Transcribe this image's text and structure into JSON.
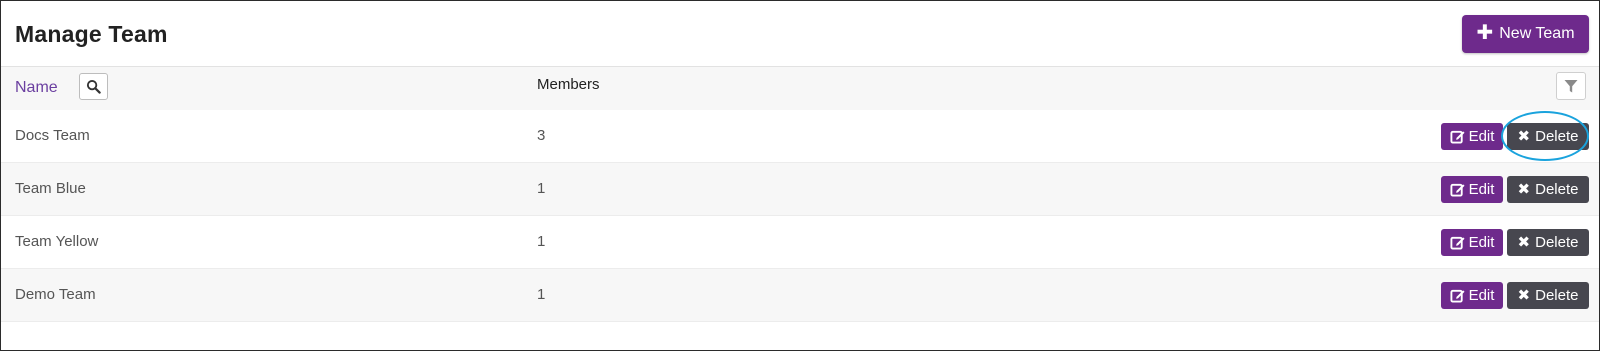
{
  "header": {
    "title": "Manage Team",
    "new_team_label": "New Team",
    "new_team_icon": "plus-icon"
  },
  "columns": {
    "name": "Name",
    "members": "Members",
    "search_icon": "search-icon",
    "filter_icon": "filter-icon"
  },
  "rows": [
    {
      "name": "Docs Team",
      "members": "3",
      "edit_label": "Edit",
      "delete_label": "Delete"
    },
    {
      "name": "Team Blue",
      "members": "1",
      "edit_label": "Edit",
      "delete_label": "Delete"
    },
    {
      "name": "Team Yellow",
      "members": "1",
      "edit_label": "Edit",
      "delete_label": "Delete"
    },
    {
      "name": "Demo Team",
      "members": "1",
      "edit_label": "Edit",
      "delete_label": "Delete"
    }
  ],
  "colors": {
    "brand_purple": "#6e2a8c",
    "delete_gray": "#47474f",
    "link_purple": "#6b3fa0",
    "highlight_blue": "#1aa3dd"
  }
}
